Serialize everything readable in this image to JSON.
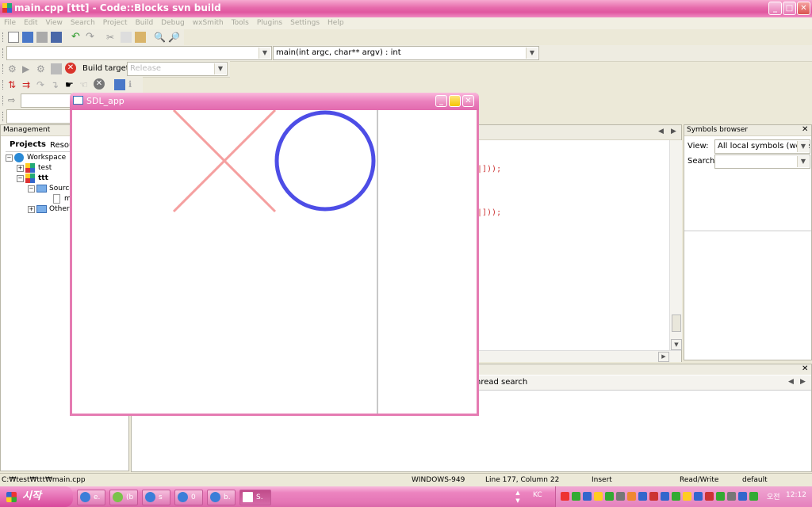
{
  "window": {
    "title": "main.cpp [ttt] - Code::Blocks svn build"
  },
  "menu": [
    "File",
    "Edit",
    "View",
    "Search",
    "Project",
    "Build",
    "Debug",
    "wxSmith",
    "Tools",
    "Plugins",
    "Settings",
    "Help"
  ],
  "toolbar": {
    "function_combo": "main(int argc, char** argv) : int",
    "build_target_label": "Build target:",
    "build_target_value": "Release"
  },
  "management": {
    "title": "Management",
    "tabs": [
      "Projects",
      "Resou"
    ],
    "tree": [
      {
        "label": "Workspace",
        "indent": 0
      },
      {
        "label": "test",
        "indent": 1
      },
      {
        "label": "ttt",
        "indent": 1,
        "bold": true
      },
      {
        "label": "Source",
        "indent": 2
      },
      {
        "label": "m",
        "indent": 3
      },
      {
        "label": "Other",
        "indent": 2
      }
    ]
  },
  "editor": {
    "code_fragments": [
      "|]));",
      "|]));"
    ]
  },
  "symbols": {
    "title": "Symbols browser",
    "view_label": "View:",
    "view_value": "All local symbols (works",
    "search_label": "Search:"
  },
  "logs": {
    "tab": "hread search"
  },
  "sdl": {
    "title": "SDL_app"
  },
  "status": {
    "path": "C:₩test₩ttt₩main.cpp",
    "encoding": "WINDOWS-949",
    "position": "Line 177, Column 22",
    "mode": "Insert",
    "access": "Read/Write",
    "profile": "default"
  },
  "taskbar": {
    "start": "시작",
    "buttons": [
      "e.",
      "(b",
      "s",
      "0",
      "b.",
      "S."
    ],
    "lang": "KC",
    "ampm": "오전",
    "clock": "12:12"
  },
  "colors": {
    "title_pink": "#e0579f",
    "x_mark": "#f5a0a0",
    "o_mark": "#4d4de6"
  }
}
